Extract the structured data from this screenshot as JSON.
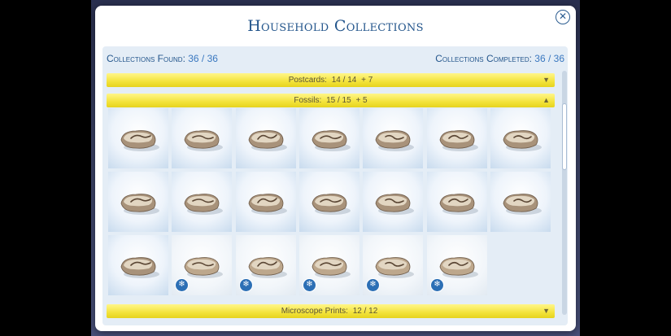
{
  "dialog": {
    "title": "Household Collections",
    "close_glyph": "✕"
  },
  "stats": {
    "found_label": "Collections Found:",
    "found_value": "36 / 36",
    "completed_label": "Collections Completed:",
    "completed_value": "36 / 36"
  },
  "categories": [
    {
      "name": "Postcards:",
      "count": "14 / 14",
      "bonus": "+ 7",
      "state": "collapsed",
      "arrow": "▼"
    },
    {
      "name": "Fossils:",
      "count": "15 / 15",
      "bonus": "+ 5",
      "state": "expanded",
      "arrow": "▲"
    },
    {
      "name": "Microscope Prints:",
      "count": "12 / 12",
      "bonus": "",
      "state": "collapsed",
      "arrow": "▼"
    }
  ],
  "fossils": {
    "items": [
      {
        "icon": "fossil-icon",
        "badge": false
      },
      {
        "icon": "fossil-icon",
        "badge": false
      },
      {
        "icon": "fossil-icon",
        "badge": false
      },
      {
        "icon": "fossil-icon",
        "badge": false
      },
      {
        "icon": "fossil-icon",
        "badge": false
      },
      {
        "icon": "fossil-icon",
        "badge": false
      },
      {
        "icon": "fossil-icon",
        "badge": false
      },
      {
        "icon": "fossil-icon",
        "badge": false
      },
      {
        "icon": "fossil-icon",
        "badge": false
      },
      {
        "icon": "fossil-icon",
        "badge": false
      },
      {
        "icon": "fossil-icon",
        "badge": false
      },
      {
        "icon": "fossil-icon",
        "badge": false
      },
      {
        "icon": "fossil-icon",
        "badge": false
      },
      {
        "icon": "fossil-icon",
        "badge": false
      },
      {
        "icon": "fossil-icon",
        "badge": false
      },
      {
        "icon": "fossil-icon",
        "badge": true
      },
      {
        "icon": "fossil-icon",
        "badge": true
      },
      {
        "icon": "fossil-icon",
        "badge": true
      },
      {
        "icon": "fossil-icon",
        "badge": true
      },
      {
        "icon": "fossil-icon",
        "badge": true
      }
    ],
    "badge_icon": "snowflake-icon",
    "badge_glyph": "❄"
  },
  "colors": {
    "title": "#24568c",
    "bar": "#f3e33b",
    "badge": "#2c6fb5"
  }
}
